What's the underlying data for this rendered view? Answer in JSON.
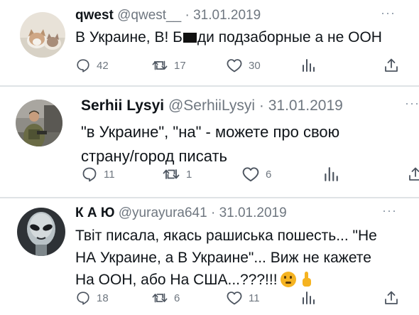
{
  "tweets": [
    {
      "name": "qwest",
      "handle": "@qwest__",
      "separator": "·",
      "date": "31.01.2019",
      "more": "···",
      "text_before": "В Украине, В! Б",
      "text_after": "ди подзаборные а не ООН",
      "replies": "42",
      "retweets": "17",
      "likes": "30"
    },
    {
      "name": "Serhii Lysyi",
      "handle": "@SerhiiLysyi",
      "separator": "·",
      "date": "31.01.2019",
      "more": "···",
      "lines": [
        "\"в Украине\", \"на\" - можете про свою",
        "страну/город писать"
      ],
      "replies": "11",
      "retweets": "1",
      "likes": "6"
    },
    {
      "name": "К А Ю",
      "handle": "@yurayura641",
      "separator": "·",
      "date": "31.01.2019",
      "more": "···",
      "lines": [
        "Твіт писала, якась рашиська пошесть... \"Не",
        "НА Украине, а В Украине\"... Виж не кажете",
        "На ООН, або На США...???!!!"
      ],
      "emoji": [
        "thinking-face",
        "index-pointing-up"
      ],
      "replies": "18",
      "retweets": "6",
      "likes": "11"
    }
  ],
  "colors": {
    "text": "#0f1419",
    "secondary": "#6f7780",
    "divider": "#dfe3e6"
  }
}
